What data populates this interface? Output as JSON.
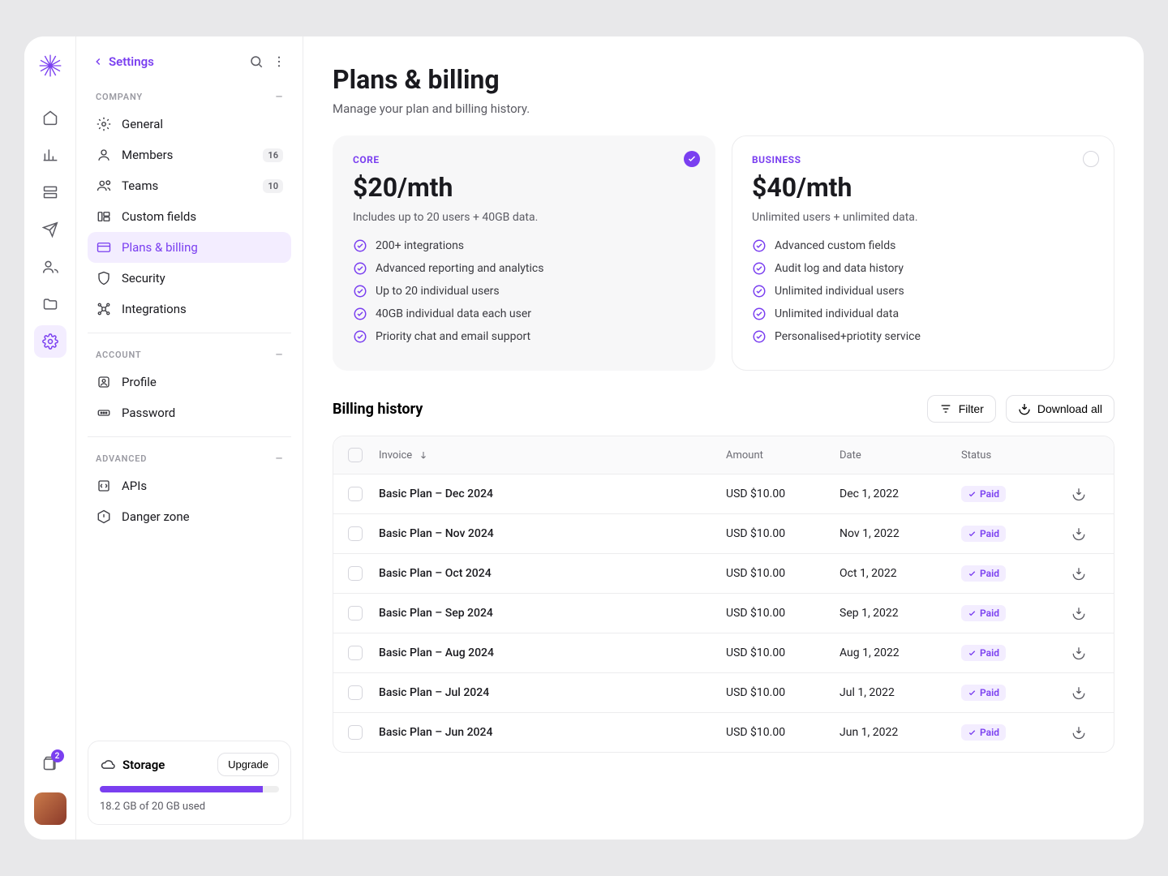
{
  "rail": {
    "notif_count": "2"
  },
  "sidebar": {
    "back_label": "Settings",
    "sections": {
      "company": {
        "label": "COMPANY",
        "items": [
          {
            "label": "General"
          },
          {
            "label": "Members",
            "count": "16"
          },
          {
            "label": "Teams",
            "count": "10"
          },
          {
            "label": "Custom fields"
          },
          {
            "label": "Plans & billing"
          },
          {
            "label": "Security"
          },
          {
            "label": "Integrations"
          }
        ]
      },
      "account": {
        "label": "ACCOUNT",
        "items": [
          {
            "label": "Profile"
          },
          {
            "label": "Password"
          }
        ]
      },
      "advanced": {
        "label": "ADVANCED",
        "items": [
          {
            "label": "APIs"
          },
          {
            "label": "Danger zone"
          }
        ]
      }
    },
    "storage": {
      "title": "Storage",
      "upgrade": "Upgrade",
      "used_text": "18.2 GB of 20 GB used"
    }
  },
  "page": {
    "title": "Plans & billing",
    "subtitle": "Manage your plan and billing history."
  },
  "plans": [
    {
      "kicker": "CORE",
      "price": "$20/mth",
      "desc": "Includes up to 20 users + 40GB data.",
      "features": [
        "200+ integrations",
        "Advanced reporting and analytics",
        "Up to 20 individual users",
        "40GB individual data each user",
        "Priority chat and email support"
      ]
    },
    {
      "kicker": "BUSINESS",
      "price": "$40/mth",
      "desc": "Unlimited users + unlimited data.",
      "features": [
        "Advanced custom fields",
        "Audit log and data history",
        "Unlimited individual users",
        "Unlimited individual data",
        "Personalised+priotity service"
      ]
    }
  ],
  "billing": {
    "title": "Billing history",
    "filter": "Filter",
    "download_all": "Download all",
    "columns": {
      "invoice": "Invoice",
      "amount": "Amount",
      "date": "Date",
      "status": "Status"
    },
    "rows": [
      {
        "invoice": "Basic Plan – Dec 2024",
        "amount": "USD $10.00",
        "date": "Dec 1, 2022",
        "status": "Paid"
      },
      {
        "invoice": "Basic Plan – Nov 2024",
        "amount": "USD $10.00",
        "date": "Nov 1, 2022",
        "status": "Paid"
      },
      {
        "invoice": "Basic Plan – Oct 2024",
        "amount": "USD $10.00",
        "date": "Oct 1, 2022",
        "status": "Paid"
      },
      {
        "invoice": "Basic Plan – Sep 2024",
        "amount": "USD $10.00",
        "date": "Sep 1, 2022",
        "status": "Paid"
      },
      {
        "invoice": "Basic Plan – Aug 2024",
        "amount": "USD $10.00",
        "date": "Aug 1, 2022",
        "status": "Paid"
      },
      {
        "invoice": "Basic Plan – Jul 2024",
        "amount": "USD $10.00",
        "date": "Jul 1, 2022",
        "status": "Paid"
      },
      {
        "invoice": "Basic Plan – Jun 2024",
        "amount": "USD $10.00",
        "date": "Jun 1, 2022",
        "status": "Paid"
      }
    ]
  }
}
